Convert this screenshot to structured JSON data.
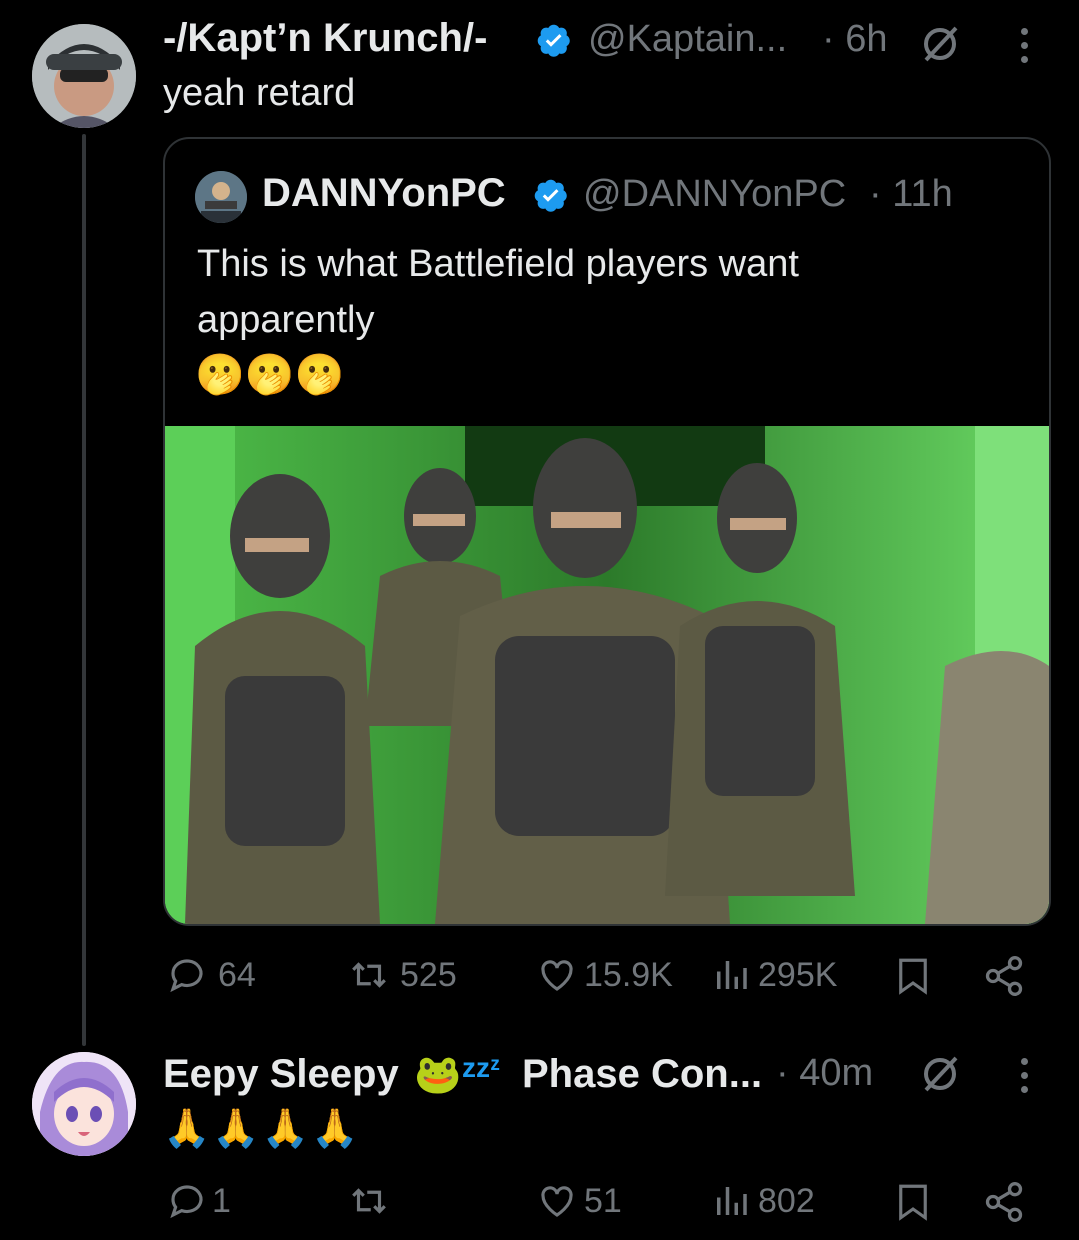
{
  "tweet1": {
    "display_name": "-/Kapt’n Krunch/-",
    "handle": "@Kaptain...",
    "time": "· 6h",
    "text": "yeah retard"
  },
  "quoted": {
    "display_name": "DANNYonPC",
    "handle": "@DANNYonPC",
    "time": "· 11h",
    "text_line1": "This is what Battlefield players want",
    "text_line2": "apparently",
    "emojis": "🫢🫢🫢"
  },
  "actions1": {
    "replies": "64",
    "reposts": "525",
    "likes": "15.9K",
    "views": "295K"
  },
  "tweet2": {
    "display_name_part1": "Eepy Sleepy",
    "emoji": "🐸",
    "zzz": "zzᶻ",
    "display_name_part2": "Phase Con...",
    "time": "· 40m",
    "text": "🙏🙏🙏🙏"
  },
  "actions2": {
    "replies": "1",
    "reposts": "",
    "likes": "51",
    "views": "802"
  },
  "colors": {
    "background": "#000000",
    "text": "#e7e9ea",
    "muted": "#71767b",
    "verified": "#1d9bf0",
    "image_green": "#5fd15a"
  }
}
